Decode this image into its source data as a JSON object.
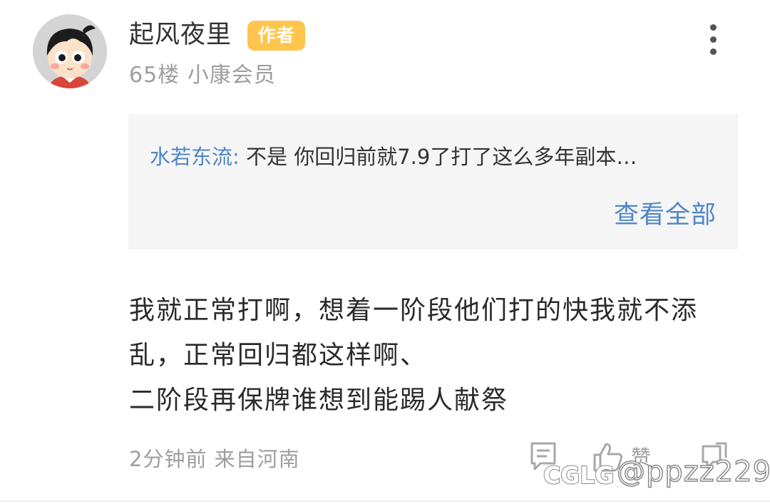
{
  "post": {
    "author": "起风夜里",
    "author_badge": "作者",
    "meta": "65楼 小康会员",
    "quote": {
      "author": "水若东流:",
      "text": "不是 你回归前就7.9了打了这么多年副本…",
      "view_all": "查看全部"
    },
    "content_lines": [
      "我就正常打啊，想着一阶段他们打的快我就不添",
      "乱，正常回归都这样啊、",
      "二阶段再保牌谁想到能踢人献祭"
    ],
    "footer": {
      "time_location": "2分钟前 来自河南",
      "like_label": "赞"
    },
    "icons": [
      "more-vertical-icon",
      "comment-icon",
      "thumbs-up-icon",
      "share-icon"
    ]
  },
  "watermark": {
    "logo": "CGLG",
    "handle": "@ppzz229"
  },
  "colors": {
    "badge": "#ffc54d",
    "link": "#4e86c8",
    "quote_bg": "#f5f5f5",
    "secondary_text": "#9e9e9e"
  }
}
